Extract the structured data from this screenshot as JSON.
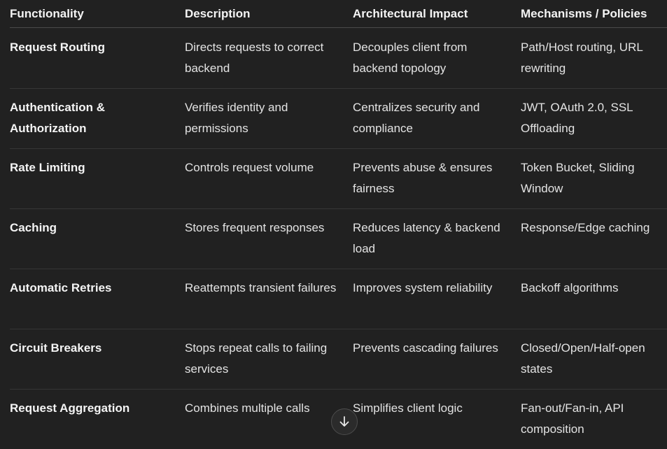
{
  "table": {
    "headers": [
      "Functionality",
      "Description",
      "Architectural Impact",
      "Mechanisms / Policies"
    ],
    "rows": [
      [
        "Request Routing",
        "Directs requests to correct backend",
        "Decouples client from backend topology",
        "Path/Host routing, URL rewriting"
      ],
      [
        "Authentication & Authorization",
        "Verifies identity and permissions",
        "Centralizes security and compliance",
        "JWT, OAuth 2.0, SSL Offloading"
      ],
      [
        "Rate Limiting",
        "Controls request volume",
        "Prevents abuse & ensures fairness",
        "Token Bucket, Sliding Window"
      ],
      [
        "Caching",
        "Stores frequent responses",
        "Reduces latency & backend load",
        "Response/Edge caching"
      ],
      [
        "Automatic Retries",
        "Reattempts transient failures",
        "Improves system reliability",
        "Backoff algorithms"
      ],
      [
        "Circuit Breakers",
        "Stops repeat calls to failing services",
        "Prevents cascading failures",
        "Closed/Open/Half-open states"
      ],
      [
        "Request Aggregation",
        "Combines multiple calls",
        "Simplifies client logic",
        "Fan-out/Fan-in, API composition"
      ]
    ]
  },
  "scroll_button": {
    "icon": "arrow-down-icon"
  }
}
